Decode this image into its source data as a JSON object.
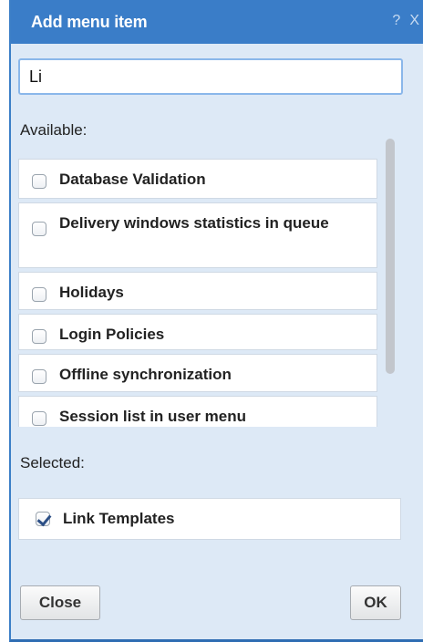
{
  "dialog": {
    "title": "Add menu item",
    "help_icon": "?",
    "close_icon": "X"
  },
  "search": {
    "value": "Li",
    "placeholder": ""
  },
  "available": {
    "label": "Available:",
    "items": [
      {
        "label": "Database Validation",
        "checked": false
      },
      {
        "label": "Delivery windows statistics in queue",
        "checked": false
      },
      {
        "label": "Holidays",
        "checked": false
      },
      {
        "label": "Login Policies",
        "checked": false
      },
      {
        "label": "Offline synchronization",
        "checked": false
      },
      {
        "label": "Session list in user menu",
        "checked": false
      }
    ]
  },
  "selected": {
    "label": "Selected:",
    "items": [
      {
        "label": "Link Templates",
        "checked": true
      }
    ]
  },
  "buttons": {
    "close": "Close",
    "ok": "OK"
  },
  "colors": {
    "titlebar": "#3a7dc8",
    "dialog_bg": "#dde9f6",
    "input_border": "#8ab7ea"
  }
}
